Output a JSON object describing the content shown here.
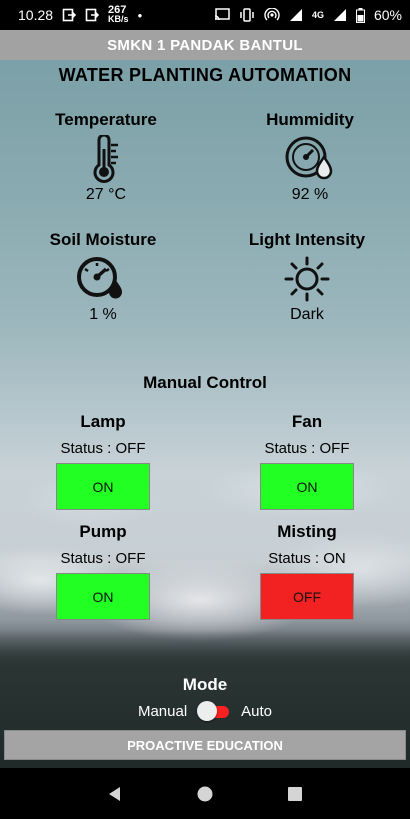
{
  "status_bar": {
    "time": "10.28",
    "net_speed_value": "267",
    "net_speed_unit": "KB/s",
    "network": "4G",
    "battery": "60%"
  },
  "header": {
    "title": "SMKN 1 PANDAK BANTUL"
  },
  "app_title": "WATER PLANTING AUTOMATION",
  "sensors": [
    {
      "label": "Temperature",
      "value": "27 °C",
      "icon": "thermometer-icon"
    },
    {
      "label": "Hummidity",
      "value": "92 %",
      "icon": "humidity-gauge-icon"
    },
    {
      "label": "Soil Moisture",
      "value": "1 %",
      "icon": "soil-moisture-gauge-icon"
    },
    {
      "label": "Light Intensity",
      "value": "Dark",
      "icon": "sun-icon"
    }
  ],
  "manual_control": {
    "title": "Manual Control",
    "devices": [
      {
        "name": "Lamp",
        "status": "Status : OFF",
        "button_label": "ON",
        "button_color": "#22ff22"
      },
      {
        "name": "Fan",
        "status": "Status : OFF",
        "button_label": "ON",
        "button_color": "#22ff22"
      },
      {
        "name": "Pump",
        "status": "Status : OFF",
        "button_label": "ON",
        "button_color": "#22ff22"
      },
      {
        "name": "Misting",
        "status": "Status : ON",
        "button_label": "OFF",
        "button_color": "#f22222"
      }
    ]
  },
  "mode": {
    "title": "Mode",
    "left_label": "Manual",
    "right_label": "Auto",
    "toggle_color": "#ff2020"
  },
  "footer": {
    "label": "PROACTIVE EDUCATION"
  }
}
